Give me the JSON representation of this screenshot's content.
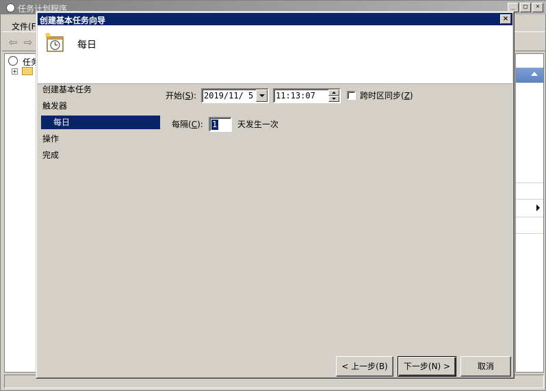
{
  "background_app": {
    "title": "任务计划程序",
    "menu_file": "文件(F",
    "tree_item": "任务",
    "win_minimize": "_",
    "win_maximize": "□",
    "win_close": "×"
  },
  "wizard": {
    "title": "创建基本任务向导",
    "close_glyph": "×",
    "header_title": "每日",
    "steps": [
      {
        "label": "创建基本任务"
      },
      {
        "label": "触发器"
      },
      {
        "label": "每日"
      },
      {
        "label": "操作"
      },
      {
        "label": "完成"
      }
    ],
    "active_step": 2,
    "start": {
      "label": "开始(",
      "accel": "S",
      "label_end": "):",
      "date": "2019/11/ 5",
      "time": "11:13:07"
    },
    "sync_timezone": {
      "label": "跨时区同步(",
      "accel": "Z",
      "label_end": ")",
      "checked": false
    },
    "recur": {
      "label": "每隔(",
      "accel": "C",
      "label_end": "):",
      "value": "1",
      "suffix": "天发生一次"
    },
    "buttons": {
      "back": "< 上一步(B)",
      "next": "下一步(N) >",
      "cancel": "取消"
    }
  }
}
